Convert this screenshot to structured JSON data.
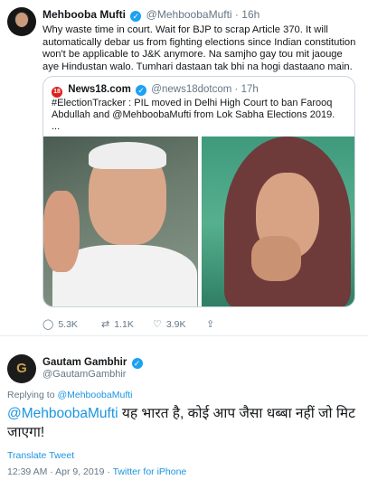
{
  "quoted_parent": {
    "author_name": "Mehbooba Mufti",
    "author_handle": "@MehboobaMufti",
    "time": "16h",
    "text": "Why waste time in court. Wait for BJP to scrap Article 370. It will automatically debar us from fighting elections since Indian constitution won't be applicable to J&K anymore. Na samjho gay tou mit jaouge aye Hindustan walo. Tumhari dastaan tak bhi na hogi dastaano main.",
    "quote": {
      "logo_text": "18",
      "source_name": "News18.com",
      "source_handle": "@news18dotcom",
      "time": "17h",
      "text": "#ElectionTracker : PIL moved in Delhi High Court to ban Farooq Abdullah and @MehboobaMufti  from Lok Sabha Elections 2019.",
      "ellipsis": "..."
    },
    "actions": {
      "reply_count": "5.3K",
      "retweet_count": "1.1K",
      "like_count": "3.9K"
    }
  },
  "main_tweet": {
    "author_name": "Gautam Gambhir",
    "author_handle": "@GautamGambhir",
    "avatar_letter": "G",
    "replying_prefix": "Replying to",
    "replying_to": "@MehboobaMufti",
    "mention": "@MehboobaMufti",
    "text": " यह भारत है, कोई आप जैसा धब्बा नहीं जो मिट जाएगा!",
    "translate_label": "Translate Tweet",
    "timestamp": "12:39 AM · Apr 9, 2019 ·",
    "client": "Twitter for iPhone"
  },
  "icons": {
    "verified": "verified-badge-icon",
    "reply": "reply-icon",
    "retweet": "retweet-icon",
    "like": "heart-icon",
    "share": "share-icon"
  },
  "colors": {
    "link": "#1b95e0",
    "verified": "#1da1f2",
    "muted": "#657786",
    "news18_red": "#e0201b"
  }
}
